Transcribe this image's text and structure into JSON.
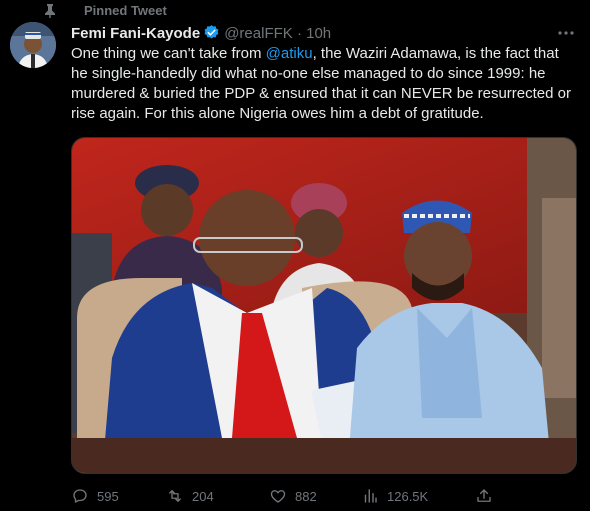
{
  "pinned": {
    "label": "Pinned Tweet"
  },
  "tweet": {
    "author_name": "Femi Fani-Kayode",
    "handle": "@realFFK",
    "separator": "·",
    "time": "10h",
    "text_before_mention": "One thing we can't take from ",
    "mention": "@atiku",
    "text_after_mention": ", the Waziri Adamawa, is the fact that he single-handedly did what no-one else managed to do since 1999: he murdered & buried the PDP & ensured that it can NEVER be resurrected or rise again. For this alone Nigeria owes him a debt of gratitude."
  },
  "stats": {
    "replies": "595",
    "retweets": "204",
    "likes": "882",
    "views": "126.5K"
  },
  "colors": {
    "background": "#000000",
    "text": "#e7e9ea",
    "muted": "#71767b",
    "accent": "#1d9bf0"
  },
  "icons": [
    "pin-icon",
    "verified-icon",
    "more-icon",
    "reply-icon",
    "retweet-icon",
    "like-icon",
    "views-icon",
    "share-icon"
  ]
}
